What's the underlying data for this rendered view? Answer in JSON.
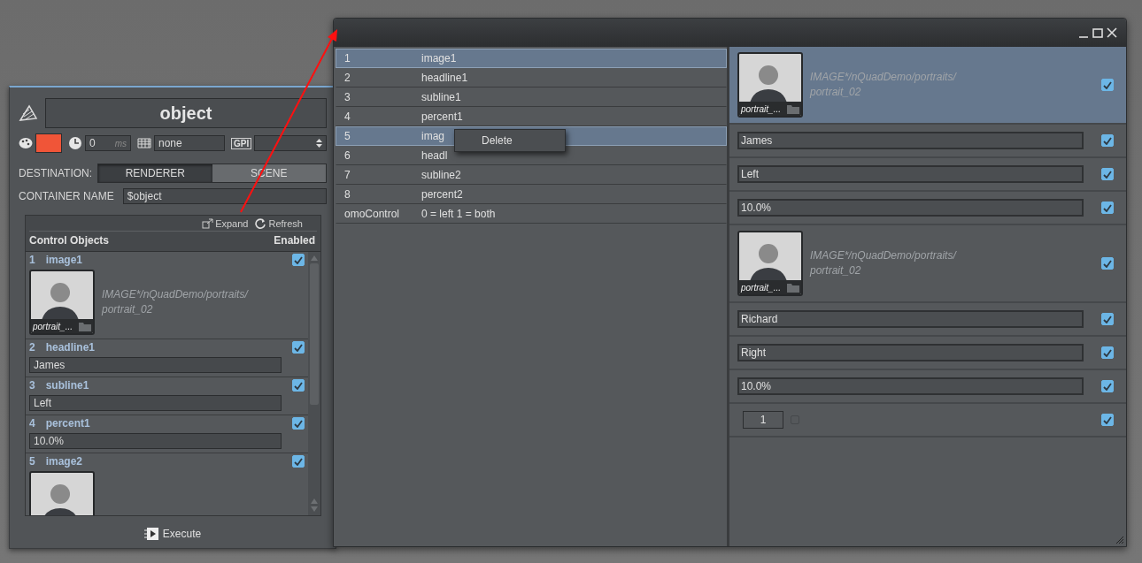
{
  "control_panel": {
    "title": "object",
    "color": "#f05538",
    "delay": {
      "value": "0",
      "unit": "ms"
    },
    "layer": "none",
    "gpi": "GPI",
    "destination": {
      "label": "DESTINATION:",
      "options": [
        {
          "label": "RENDERER",
          "selected": true
        },
        {
          "label": "SCENE",
          "selected": false
        }
      ]
    },
    "container_name": {
      "label": "CONTAINER NAME",
      "value": "$object"
    },
    "toolbar": [
      {
        "kind": "expand",
        "label": "Expand"
      },
      {
        "kind": "refresh",
        "label": "Refresh"
      }
    ],
    "columns": [
      "Control Objects",
      "Enabled"
    ],
    "items": [
      {
        "index": "1",
        "name": "image1",
        "kind": "image",
        "enabled": true,
        "caption": "portrait_...",
        "path_lines": [
          "IMAGE*/nQuadDemo/portraits/",
          "portrait_02"
        ]
      },
      {
        "index": "2",
        "name": "headline1",
        "kind": "text",
        "enabled": true,
        "value": "James"
      },
      {
        "index": "3",
        "name": "subline1",
        "kind": "text",
        "enabled": true,
        "value": "Left"
      },
      {
        "index": "4",
        "name": "percent1",
        "kind": "text",
        "enabled": true,
        "value": "10.0%"
      },
      {
        "index": "5",
        "name": "image2",
        "kind": "image",
        "enabled": true
      }
    ],
    "execute": "Execute"
  },
  "window": {
    "table_rows": [
      {
        "index": "1",
        "name": "image1",
        "selected": true
      },
      {
        "index": "2",
        "name": "headline1",
        "selected": false
      },
      {
        "index": "3",
        "name": "subline1",
        "selected": false
      },
      {
        "index": "4",
        "name": "percent1",
        "selected": false
      },
      {
        "index": "5",
        "name": "imag",
        "selected": true
      },
      {
        "index": "6",
        "name": "headl",
        "selected": false
      },
      {
        "index": "7",
        "name": "subline2",
        "selected": false
      },
      {
        "index": "8",
        "name": "percent2",
        "selected": false
      },
      {
        "index": "omoControl",
        "name": "0 = left 1 = both",
        "selected": false
      }
    ],
    "context_menu": [
      "Delete"
    ],
    "details": [
      {
        "kind": "image",
        "selected": true,
        "enabled": true,
        "caption": "portrait_...",
        "path_lines": [
          "IMAGE*/nQuadDemo/portraits/",
          "portrait_02"
        ]
      },
      {
        "kind": "text",
        "selected": false,
        "enabled": true,
        "value": "James"
      },
      {
        "kind": "text",
        "selected": false,
        "enabled": true,
        "value": "Left"
      },
      {
        "kind": "text",
        "selected": false,
        "enabled": true,
        "value": "10.0%"
      },
      {
        "kind": "image",
        "selected": false,
        "enabled": true,
        "caption": "portrait_...",
        "path_lines": [
          "IMAGE*/nQuadDemo/portraits/",
          "portrait_02"
        ]
      },
      {
        "kind": "text",
        "selected": false,
        "enabled": true,
        "value": "Richard"
      },
      {
        "kind": "text",
        "selected": false,
        "enabled": true,
        "value": "Right"
      },
      {
        "kind": "text",
        "selected": false,
        "enabled": true,
        "value": "10.0%"
      },
      {
        "kind": "number",
        "selected": false,
        "enabled": true,
        "value": "1",
        "checked": false
      }
    ]
  }
}
